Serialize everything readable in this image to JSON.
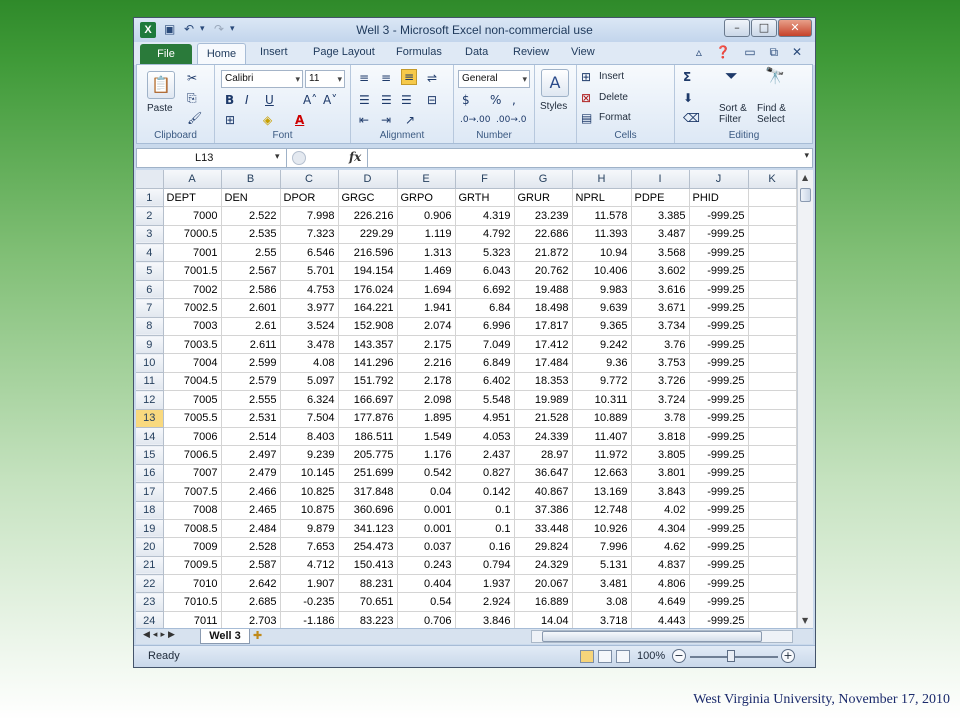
{
  "window": {
    "title": "Well 3  -  Microsoft Excel non-commercial use",
    "app_icon": "X",
    "minimize": "–",
    "maximize": "□",
    "close": "✕"
  },
  "tabs": [
    "File",
    "Home",
    "Insert",
    "Page Layout",
    "Formulas",
    "Data",
    "Review",
    "View"
  ],
  "ribbon": {
    "clipboard": {
      "label": "Clipboard",
      "paste": "Paste"
    },
    "font": {
      "label": "Font",
      "name": "Calibri",
      "size": "11"
    },
    "alignment": {
      "label": "Alignment"
    },
    "number": {
      "label": "Number",
      "format": "General"
    },
    "styles": {
      "label": "Styles"
    },
    "cells": {
      "label": "Cells",
      "insert": "Insert",
      "delete": "Delete",
      "format": "Format"
    },
    "editing": {
      "label": "Editing",
      "sort": "Sort &",
      "filter": "Filter",
      "find": "Find &",
      "select": "Select"
    }
  },
  "formula_bar": {
    "name_box": "L13",
    "fx": "fx",
    "value": ""
  },
  "grid": {
    "columns": [
      "A",
      "B",
      "C",
      "D",
      "E",
      "F",
      "G",
      "H",
      "I",
      "J",
      "K"
    ],
    "selected_row": 13,
    "header": [
      "DEPT",
      "DEN",
      "DPOR",
      "GRGC",
      "GRPO",
      "GRTH",
      "GRUR",
      "NPRL",
      "PDPE",
      "PHID"
    ],
    "rows": [
      [
        "7000",
        "2.522",
        "7.998",
        "226.216",
        "0.906",
        "4.319",
        "23.239",
        "11.578",
        "3.385",
        "-999.25"
      ],
      [
        "7000.5",
        "2.535",
        "7.323",
        "229.29",
        "1.119",
        "4.792",
        "22.686",
        "11.393",
        "3.487",
        "-999.25"
      ],
      [
        "7001",
        "2.55",
        "6.546",
        "216.596",
        "1.313",
        "5.323",
        "21.872",
        "10.94",
        "3.568",
        "-999.25"
      ],
      [
        "7001.5",
        "2.567",
        "5.701",
        "194.154",
        "1.469",
        "6.043",
        "20.762",
        "10.406",
        "3.602",
        "-999.25"
      ],
      [
        "7002",
        "2.586",
        "4.753",
        "176.024",
        "1.694",
        "6.692",
        "19.488",
        "9.983",
        "3.616",
        "-999.25"
      ],
      [
        "7002.5",
        "2.601",
        "3.977",
        "164.221",
        "1.941",
        "6.84",
        "18.498",
        "9.639",
        "3.671",
        "-999.25"
      ],
      [
        "7003",
        "2.61",
        "3.524",
        "152.908",
        "2.074",
        "6.996",
        "17.817",
        "9.365",
        "3.734",
        "-999.25"
      ],
      [
        "7003.5",
        "2.611",
        "3.478",
        "143.357",
        "2.175",
        "7.049",
        "17.412",
        "9.242",
        "3.76",
        "-999.25"
      ],
      [
        "7004",
        "2.599",
        "4.08",
        "141.296",
        "2.216",
        "6.849",
        "17.484",
        "9.36",
        "3.753",
        "-999.25"
      ],
      [
        "7004.5",
        "2.579",
        "5.097",
        "151.792",
        "2.178",
        "6.402",
        "18.353",
        "9.772",
        "3.726",
        "-999.25"
      ],
      [
        "7005",
        "2.555",
        "6.324",
        "166.697",
        "2.098",
        "5.548",
        "19.989",
        "10.311",
        "3.724",
        "-999.25"
      ],
      [
        "7005.5",
        "2.531",
        "7.504",
        "177.876",
        "1.895",
        "4.951",
        "21.528",
        "10.889",
        "3.78",
        "-999.25"
      ],
      [
        "7006",
        "2.514",
        "8.403",
        "186.511",
        "1.549",
        "4.053",
        "24.339",
        "11.407",
        "3.818",
        "-999.25"
      ],
      [
        "7006.5",
        "2.497",
        "9.239",
        "205.775",
        "1.176",
        "2.437",
        "28.97",
        "11.972",
        "3.805",
        "-999.25"
      ],
      [
        "7007",
        "2.479",
        "10.145",
        "251.699",
        "0.542",
        "0.827",
        "36.647",
        "12.663",
        "3.801",
        "-999.25"
      ],
      [
        "7007.5",
        "2.466",
        "10.825",
        "317.848",
        "0.04",
        "0.142",
        "40.867",
        "13.169",
        "3.843",
        "-999.25"
      ],
      [
        "7008",
        "2.465",
        "10.875",
        "360.696",
        "0.001",
        "0.1",
        "37.386",
        "12.748",
        "4.02",
        "-999.25"
      ],
      [
        "7008.5",
        "2.484",
        "9.879",
        "341.123",
        "0.001",
        "0.1",
        "33.448",
        "10.926",
        "4.304",
        "-999.25"
      ],
      [
        "7009",
        "2.528",
        "7.653",
        "254.473",
        "0.037",
        "0.16",
        "29.824",
        "7.996",
        "4.62",
        "-999.25"
      ],
      [
        "7009.5",
        "2.587",
        "4.712",
        "150.413",
        "0.243",
        "0.794",
        "24.329",
        "5.131",
        "4.837",
        "-999.25"
      ],
      [
        "7010",
        "2.642",
        "1.907",
        "88.231",
        "0.404",
        "1.937",
        "20.067",
        "3.481",
        "4.806",
        "-999.25"
      ],
      [
        "7010.5",
        "2.685",
        "-0.235",
        "70.651",
        "0.54",
        "2.924",
        "16.889",
        "3.08",
        "4.649",
        "-999.25"
      ],
      [
        "7011",
        "2.703",
        "-1.186",
        "83.223",
        "0.706",
        "3.846",
        "14.04",
        "3.718",
        "4.443",
        "-999.25"
      ]
    ]
  },
  "sheet_tab": "Well 3",
  "status": {
    "ready": "Ready",
    "zoom": "100%"
  },
  "footer": "West Virginia University, November 17, 2010"
}
